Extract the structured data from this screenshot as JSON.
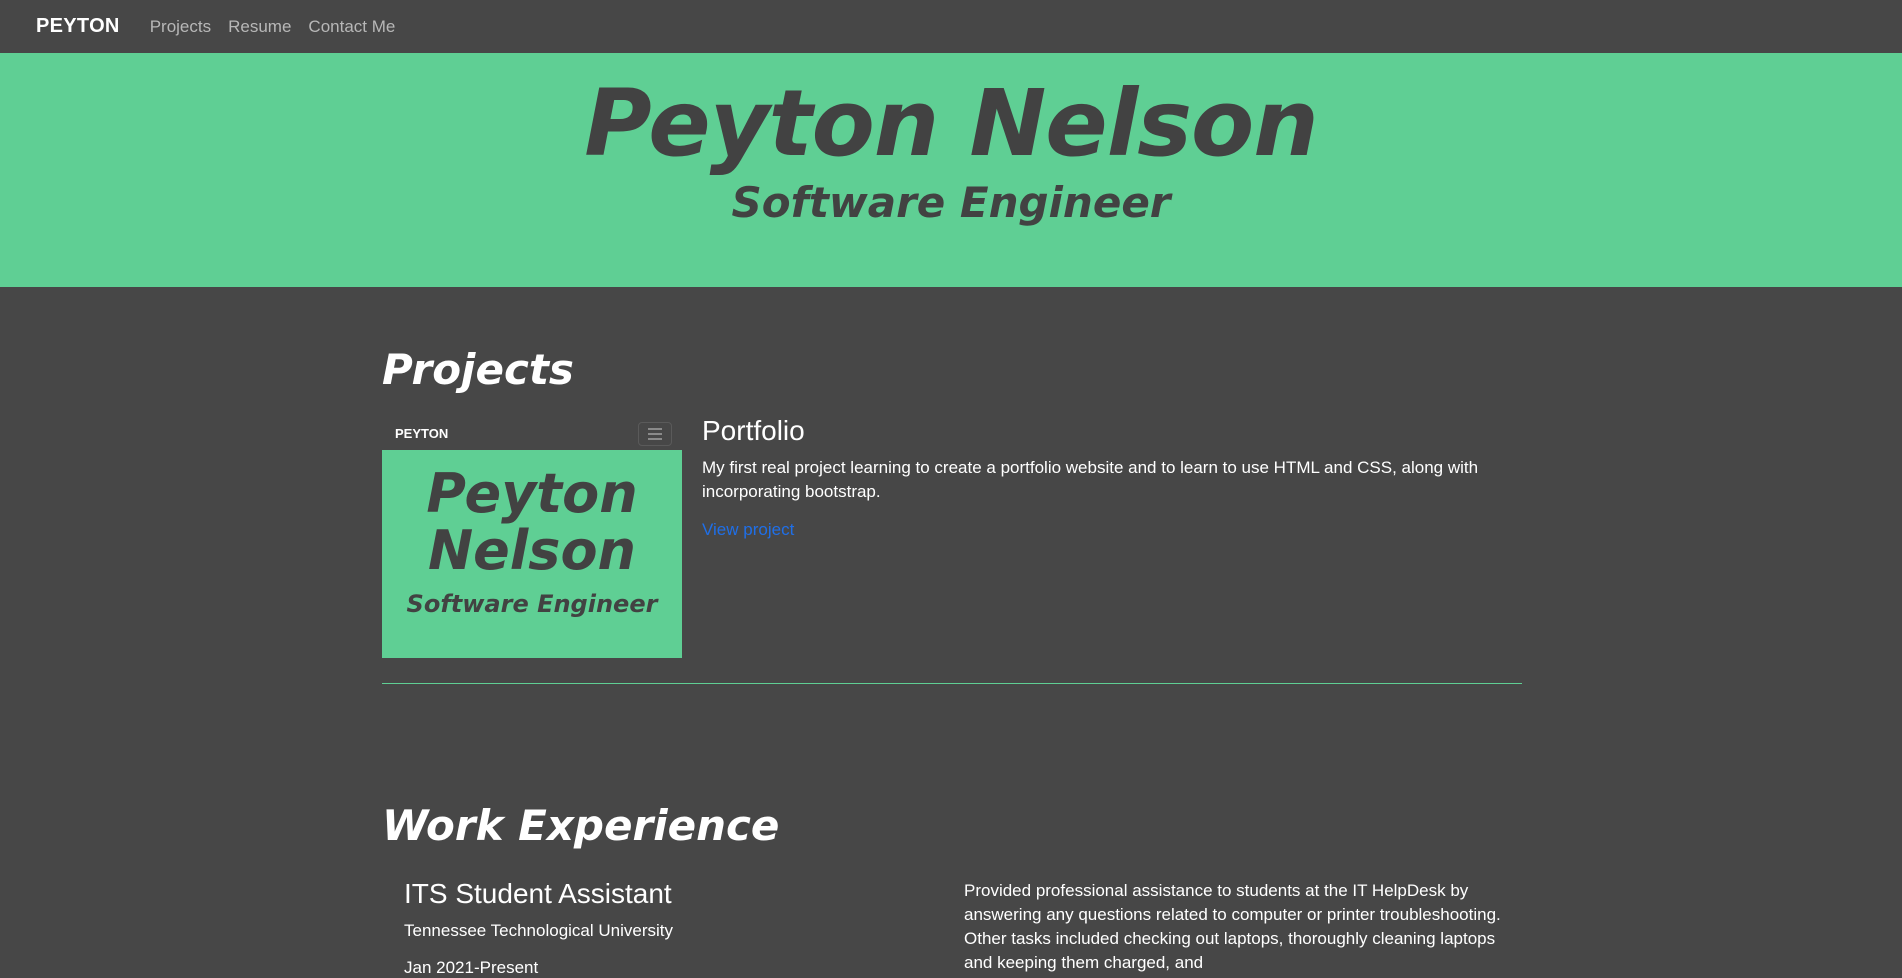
{
  "navbar": {
    "brand": "PEYTON",
    "links": [
      "Projects",
      "Resume",
      "Contact Me"
    ]
  },
  "hero": {
    "name": "Peyton Nelson",
    "title": "Software Engineer"
  },
  "projects": {
    "heading": "Projects",
    "items": [
      {
        "thumbnail": {
          "brand": "PEYTON",
          "name_line1": "Peyton",
          "name_line2": "Nelson",
          "subtitle": "Software Engineer"
        },
        "title": "Portfolio",
        "description": "My first real project learning to create a portfolio website and to learn to use HTML and CSS, along with incorporating bootstrap.",
        "link_label": "View project"
      }
    ]
  },
  "work": {
    "heading": "Work Experience",
    "jobs": [
      {
        "title": "ITS Student Assistant",
        "organization": "Tennessee Technological University",
        "dates": "Jan 2021-Present",
        "description": "Provided professional assistance to students at the IT HelpDesk by answering any questions related to computer or printer troubleshooting. Other tasks included checking out laptops, thoroughly cleaning laptops and keeping them charged, and"
      }
    ]
  },
  "colors": {
    "background": "#474747",
    "accent": "#5fcf94",
    "hero_text": "#424242",
    "link": "#1f6fe8"
  }
}
